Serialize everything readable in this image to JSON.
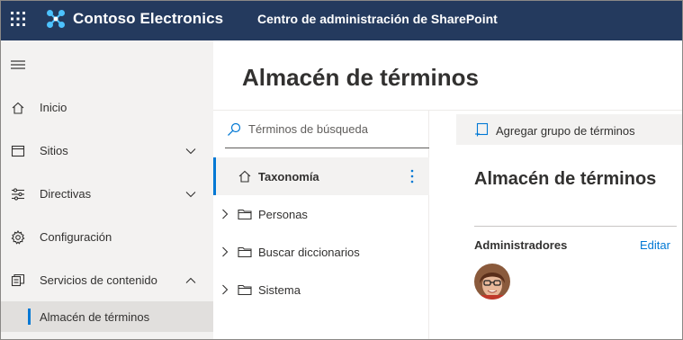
{
  "topbar": {
    "brand": "Contoso Electronics",
    "app_title": "Centro de administración de SharePoint",
    "background": "#243a5e"
  },
  "leftnav": {
    "items": [
      {
        "label": "Inicio",
        "icon": "home-icon"
      },
      {
        "label": "Sitios",
        "icon": "sites-icon",
        "expand": "chevron-down"
      },
      {
        "label": "Directivas",
        "icon": "policies-icon",
        "expand": "chevron-down"
      },
      {
        "label": "Configuración",
        "icon": "gear-icon"
      },
      {
        "label": "Servicios de contenido",
        "icon": "content-services-icon",
        "expand": "chevron-up"
      }
    ],
    "sub_item": {
      "label": "Almacén de términos",
      "selected": true
    }
  },
  "main": {
    "title": "Almacén de términos"
  },
  "tree": {
    "search_placeholder": "Términos de búsqueda",
    "items": [
      {
        "label": "Taxonomía",
        "icon": "home-icon",
        "selected": true
      },
      {
        "label": "Personas",
        "icon": "folder-icon"
      },
      {
        "label": "Buscar diccionarios",
        "icon": "folder-icon"
      },
      {
        "label": "Sistema",
        "icon": "folder-icon"
      }
    ]
  },
  "details": {
    "command": "Agregar grupo de términos",
    "title": "Almacén de términos",
    "admins_label": "Administradores",
    "edit_label": "Editar"
  },
  "colors": {
    "accent": "#0078d4",
    "nav_bg": "#f3f2f1",
    "selected_bg": "#e1dfdd"
  }
}
